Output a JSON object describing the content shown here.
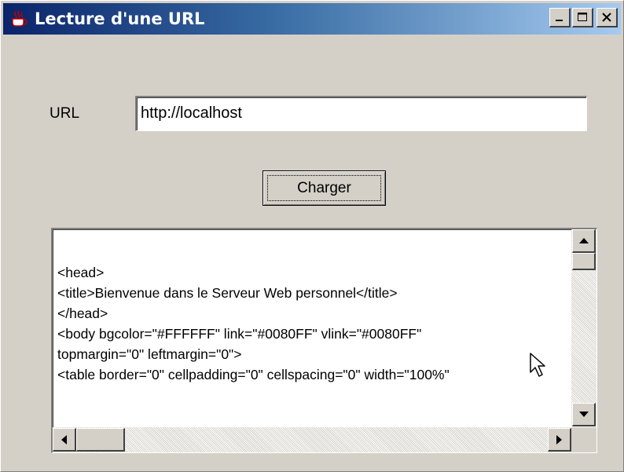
{
  "window": {
    "title": "Lecture d'une URL",
    "app_icon": "java-cup-icon",
    "controls": [
      "minimize-icon",
      "maximize-icon",
      "close-icon"
    ]
  },
  "form": {
    "url_label": "URL",
    "url_value": "http://localhost",
    "button_label": "Charger"
  },
  "content": {
    "lines": [
      "<head>",
      "<title>Bienvenue dans le Serveur Web personnel</title>",
      "</head>",
      "<body bgcolor=\"#FFFFFF\" link=\"#0080FF\" vlink=\"#0080FF\"",
      "topmargin=\"0\" leftmargin=\"0\">",
      "<table border=\"0\" cellpadding=\"0\" cellspacing=\"0\" width=\"100%\""
    ]
  },
  "colors": {
    "titlebar_start": "#0a246a",
    "titlebar_end": "#a6caf0",
    "face": "#d4d0c8"
  }
}
